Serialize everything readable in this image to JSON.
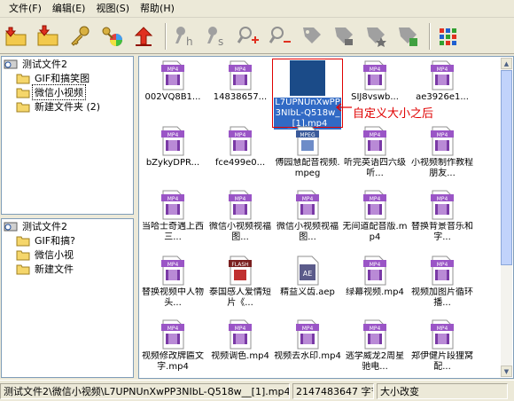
{
  "menu": [
    "文件(F)",
    "编辑(E)",
    "视图(S)",
    "帮助(H)"
  ],
  "toolbar": {
    "buttons": [
      "folder-up-icon",
      "folder-down-icon",
      "key-icon",
      "color-wheel-icon",
      "undo-arrow-icon",
      "key-h-icon",
      "key-s-icon",
      "zoom-in-icon",
      "zoom-out-icon",
      "tag-icon",
      "tag-lock-icon",
      "tag-star-icon",
      "tag-grid-icon",
      "view-grid-icon"
    ]
  },
  "tree_top": {
    "root": "测试文件2",
    "children": [
      {
        "label": "GIF和搞笑图",
        "selected": false
      },
      {
        "label": "微信小视频",
        "selected": true
      },
      {
        "label": "新建文件夹 (2)",
        "selected": false
      }
    ]
  },
  "tree_bottom": {
    "root": "测试文件2",
    "children": [
      {
        "label": "GIF和搞?"
      },
      {
        "label": "微信小视"
      },
      {
        "label": "新建文件"
      }
    ]
  },
  "files": [
    {
      "name": "002VQ8B1...",
      "type": "MP4",
      "selected": false
    },
    {
      "name": "14838657...",
      "type": "MP4",
      "selected": false
    },
    {
      "name": "L7UPNUnXwPP3NIbL-Q518w__[1].mp4",
      "type": "MP4",
      "selected": true
    },
    {
      "name": "SIJ8vswb...",
      "type": "MP4",
      "selected": false
    },
    {
      "name": "ae3926e1...",
      "type": "MP4",
      "selected": false
    },
    {
      "name": "bZykyDPR...",
      "type": "MP4",
      "selected": false
    },
    {
      "name": "fce499e0...",
      "type": "MP4",
      "selected": false
    },
    {
      "name": "傅园慧配音视频.mpeg",
      "type": "MPEG",
      "selected": false
    },
    {
      "name": "听完英语四六级听...",
      "type": "MP4",
      "selected": false
    },
    {
      "name": "小视频制作教程朋友...",
      "type": "MP4",
      "selected": false
    },
    {
      "name": "当哈士奇遇上西三...",
      "type": "MP4",
      "selected": false
    },
    {
      "name": "微信小视频视福图...",
      "type": "MP4",
      "selected": false
    },
    {
      "name": "微信小视频视福图...",
      "type": "MP4",
      "selected": false
    },
    {
      "name": "无间道配音版.mp4",
      "type": "MP4",
      "selected": false
    },
    {
      "name": "替换背景音乐和字...",
      "type": "MP4",
      "selected": false
    },
    {
      "name": "替换视频中人物头...",
      "type": "MP4",
      "selected": false
    },
    {
      "name": "泰国感人爱情短片《...",
      "type": "FLASH",
      "selected": false
    },
    {
      "name": "精益义齿.aep",
      "type": "AE",
      "selected": false
    },
    {
      "name": "绿幕视频.mp4",
      "type": "MP4",
      "selected": false
    },
    {
      "name": "视频加图片循环播...",
      "type": "MP4",
      "selected": false
    },
    {
      "name": "视频修改牌匾文字.mp4",
      "type": "MP4",
      "selected": false
    },
    {
      "name": "视频调色.mp4",
      "type": "MP4",
      "selected": false
    },
    {
      "name": "视频去水印.mp4",
      "type": "MP4",
      "selected": false
    },
    {
      "name": "逃学威龙2周星驰电...",
      "type": "MP4",
      "selected": false
    },
    {
      "name": "郑伊健片段狸窝配...",
      "type": "MP4",
      "selected": false
    }
  ],
  "annotation": {
    "text": "自定义大小之后",
    "color": "#e00000"
  },
  "status": {
    "path": "测试文件2\\微信小视频\\L7UPNUnXwPP3NIbL-Q518w__[1].mp4",
    "size": "2147483647 字节",
    "mode": "大小改变"
  },
  "colors": {
    "selection": "#316ac5",
    "icon_purple": "#9a55c6",
    "annotation_red": "#e00000"
  }
}
